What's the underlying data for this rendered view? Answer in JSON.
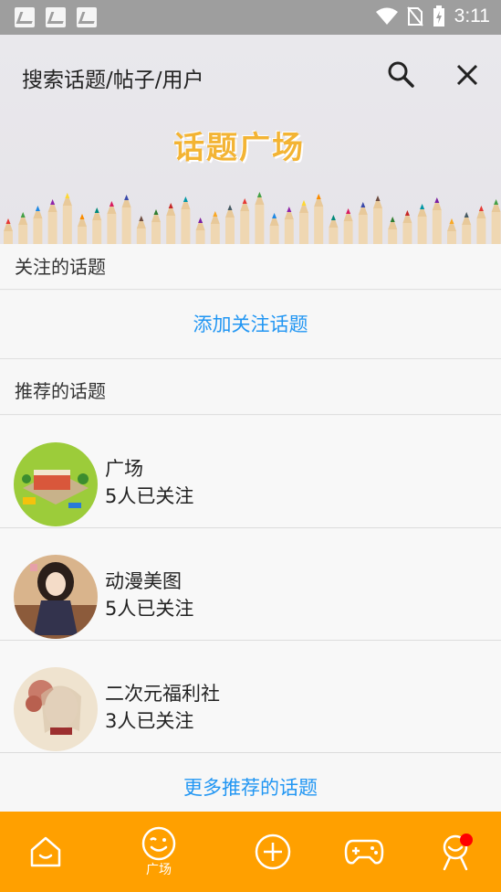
{
  "status_bar": {
    "time": "3:11"
  },
  "header": {
    "search_title": "搜索话题/帖子/用户",
    "banner_logo": "话题广场"
  },
  "followed": {
    "heading": "关注的话题",
    "add_link": "添加关注话题"
  },
  "recommended": {
    "heading": "推荐的话题",
    "topics": [
      {
        "name": "广场",
        "followers": "5人已关注"
      },
      {
        "name": "动漫美图",
        "followers": "5人已关注"
      },
      {
        "name": "二次元福利社",
        "followers": "3人已关注"
      }
    ],
    "more_link": "更多推荐的话题"
  },
  "tabbar": {
    "active_label": "广场",
    "accent_color": "#ffa000"
  }
}
